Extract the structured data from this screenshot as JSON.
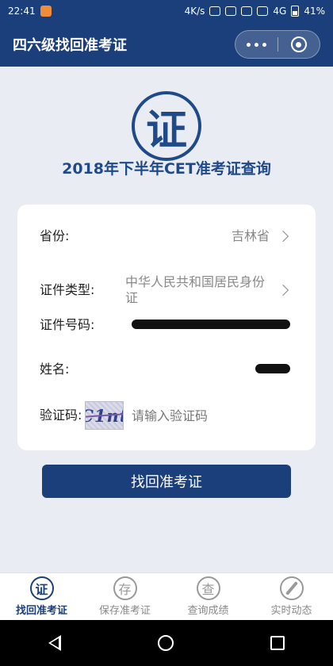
{
  "status_bar": {
    "time": "22:41",
    "speed": "4K/s",
    "network": "4G",
    "battery": "41%"
  },
  "titlebar": {
    "title": "四六级找回准考证"
  },
  "logo": {
    "char": "证"
  },
  "heading": "2018年下半年CET准考证查询",
  "form": {
    "province": {
      "label": "省份:",
      "value": "吉林省"
    },
    "id_type": {
      "label": "证件类型:",
      "value": "中华人民共和国居民身份证"
    },
    "id_number": {
      "label": "证件号码:"
    },
    "name": {
      "label": "姓名:"
    },
    "captcha": {
      "label": "验证码:",
      "image_text": "C1nt",
      "placeholder": "请输入验证码"
    }
  },
  "submit_button": "找回准考证",
  "tabs": [
    {
      "label": "找回准考证",
      "icon_char": "证",
      "active": true
    },
    {
      "label": "保存准考证",
      "icon_char": "存",
      "active": false
    },
    {
      "label": "查询成绩",
      "icon_char": "查",
      "active": false
    },
    {
      "label": "实时动态",
      "icon_char": "",
      "active": false
    }
  ],
  "colors": {
    "primary": "#1b3f7a",
    "background": "#e9ecf3",
    "card": "#ffffff"
  }
}
